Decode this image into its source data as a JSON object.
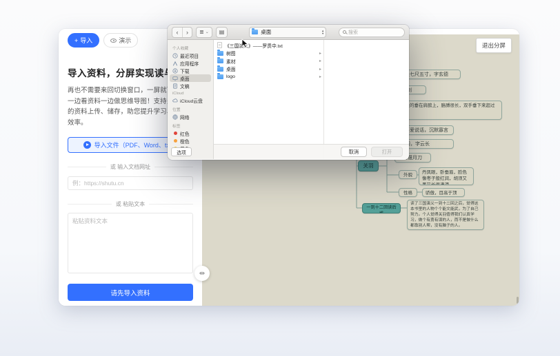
{
  "colors": {
    "accent_blue": "#3370ff",
    "canvas_beige": "#dcd9ca",
    "node_teal": "#54a098",
    "tag_red": "#e0443a",
    "tag_orange": "#f7a13d",
    "tag_yellow": "#f6ce44"
  },
  "icons": {
    "plus": "+",
    "back": "‹",
    "forward": "›",
    "list_view": "≣",
    "chevron_down": "⌄",
    "action_folder": "▤",
    "stepper_up": "▴",
    "stepper_down": "▾",
    "disclosure": "▸",
    "resize_handle": "⇹"
  },
  "app": {
    "header": {
      "import": "导入",
      "demo": "演示"
    },
    "left_panel": {
      "heading": "导入资料，分屏实现读与写",
      "description": "再也不需要来回切换窗口，一屏就可以实现一边看资料一边做思维导图！支持多种格式的资料上传、储存，助您提升学习、工作的效率。",
      "import_file_button": "导入文件（PDF、Word、txt）",
      "url_divider": "或 输入文档网址",
      "url_placeholder": "例：https://shutu.cn",
      "paste_divider": "或 粘贴文本",
      "paste_placeholder": "粘贴资料文本",
      "submit_button": "请先导入资料"
    },
    "right_panel": {
      "exit_split_button": "退出分屏"
    }
  },
  "dialog": {
    "toolbar": {
      "location": "桌面",
      "search_placeholder": "搜索"
    },
    "sidebar": {
      "sections": [
        {
          "title": "个人收藏",
          "items": [
            {
              "label": "最近项目"
            },
            {
              "label": "应用程序"
            },
            {
              "label": "下载"
            },
            {
              "label": "桌面",
              "selected": true
            },
            {
              "label": "文稿"
            }
          ]
        },
        {
          "title": "iCloud",
          "items": [
            {
              "label": "iCloud云盘"
            }
          ]
        },
        {
          "title": "位置",
          "items": [
            {
              "label": "网络"
            }
          ]
        },
        {
          "title": "标签",
          "items": [
            {
              "label": "红色"
            },
            {
              "label": "橙色"
            },
            {
              "label": "黄色"
            }
          ]
        }
      ],
      "options_button": "选项"
    },
    "files": [
      {
        "name": "《三国演义》——罗贯中.txt",
        "type": "file"
      },
      {
        "name": "树图",
        "type": "folder"
      },
      {
        "name": "素材",
        "type": "folder"
      },
      {
        "name": "桌面",
        "type": "folder"
      },
      {
        "name": "logo",
        "type": "folder"
      }
    ],
    "footer": {
      "cancel": "取消",
      "open": "打开"
    }
  },
  "mindmap": {
    "nodes": [
      {
        "text": "身长七尺五寸，字玄德"
      },
      {
        "text": "双股剑"
      },
      {
        "text": "两只耳朵长长的垂在肩膀上，胳膊很长，双手垂下来超过膝盖"
      },
      {
        "text": "平时不爱说话，沉默寡言"
      },
      {
        "text": "关羽，字云长"
      },
      {
        "text": "青龙偃月刀"
      },
      {
        "text": "关羽"
      },
      {
        "text": "外貌"
      },
      {
        "text": "丹凤眼，卧蚕眉，脸色像枣子般红润，胡须又黑又长很潇洒"
      },
      {
        "text": "性格"
      },
      {
        "text": "骄傲，目高于顶"
      },
      {
        "text": "一到十二回读后感"
      },
      {
        "text": "读了三国演义一到十二回之后，觉得这本书里的人物个个能文能武，为了自己努力。个人觉得关羽值得我们认真学习，做个有勇有谋的人，而不是做什么都靠别人帮，没有脑子的人。"
      }
    ]
  }
}
